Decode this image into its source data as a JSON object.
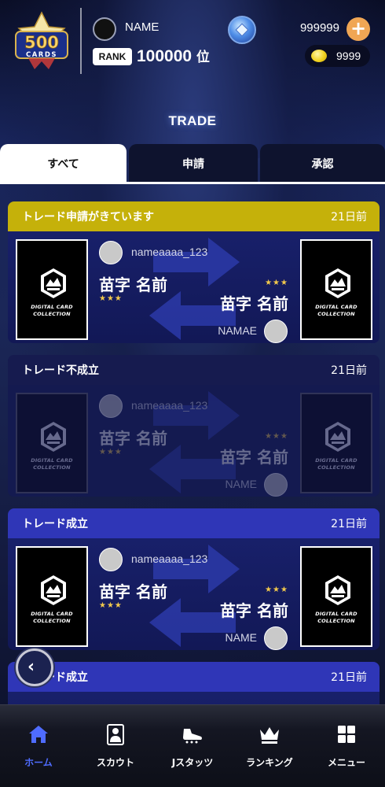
{
  "header": {
    "logo_number": "500",
    "logo_text": "CARDS",
    "user_name": "NAME",
    "rank_label": "RANK",
    "rank_value": "100000",
    "rank_unit": "位",
    "gems": "999999",
    "plus_symbol": "+",
    "coins": "9999"
  },
  "page_title": "TRADE",
  "tabs": [
    {
      "label": "すべて",
      "active": true
    },
    {
      "label": "申請",
      "active": false
    },
    {
      "label": "承認",
      "active": false
    }
  ],
  "card_caption_line1": "DIGITAL CARD",
  "card_caption_line2": "COLLECTION",
  "trades": [
    {
      "status": "トレード申請がきています",
      "when": "21日前",
      "username": "nameaaaa_123",
      "left_name": "苗字 名前",
      "left_stars": "★★★",
      "right_name": "苗字 名前",
      "right_stars": "★★★",
      "partner": "NAMAE"
    },
    {
      "status": "トレード不成立",
      "when": "21日前",
      "username": "nameaaaa_123",
      "left_name": "苗字 名前",
      "left_stars": "★★★",
      "right_name": "苗字 名前",
      "right_stars": "★★★",
      "partner": "NAME"
    },
    {
      "status": "トレード成立",
      "when": "21日前",
      "username": "nameaaaa_123",
      "left_name": "苗字 名前",
      "left_stars": "★★★",
      "right_name": "苗字 名前",
      "right_stars": "★★★",
      "partner": "NAME"
    },
    {
      "status": "トレード成立",
      "when": "21日前"
    }
  ],
  "back_symbol": "‹",
  "nav": [
    {
      "label": "ホーム",
      "icon": "home-icon",
      "active": true
    },
    {
      "label": "スカウト",
      "icon": "scout-icon",
      "active": false
    },
    {
      "label": "Jスタッツ",
      "icon": "boot-icon",
      "active": false
    },
    {
      "label": "ランキング",
      "icon": "crown-icon",
      "active": false
    },
    {
      "label": "メニュー",
      "icon": "grid-menu-icon",
      "active": false
    }
  ],
  "colors": {
    "pending_header": "#c5b10a",
    "done_header": "#2f36b7",
    "active_nav": "#4f6cff",
    "star": "#f2c94c"
  }
}
